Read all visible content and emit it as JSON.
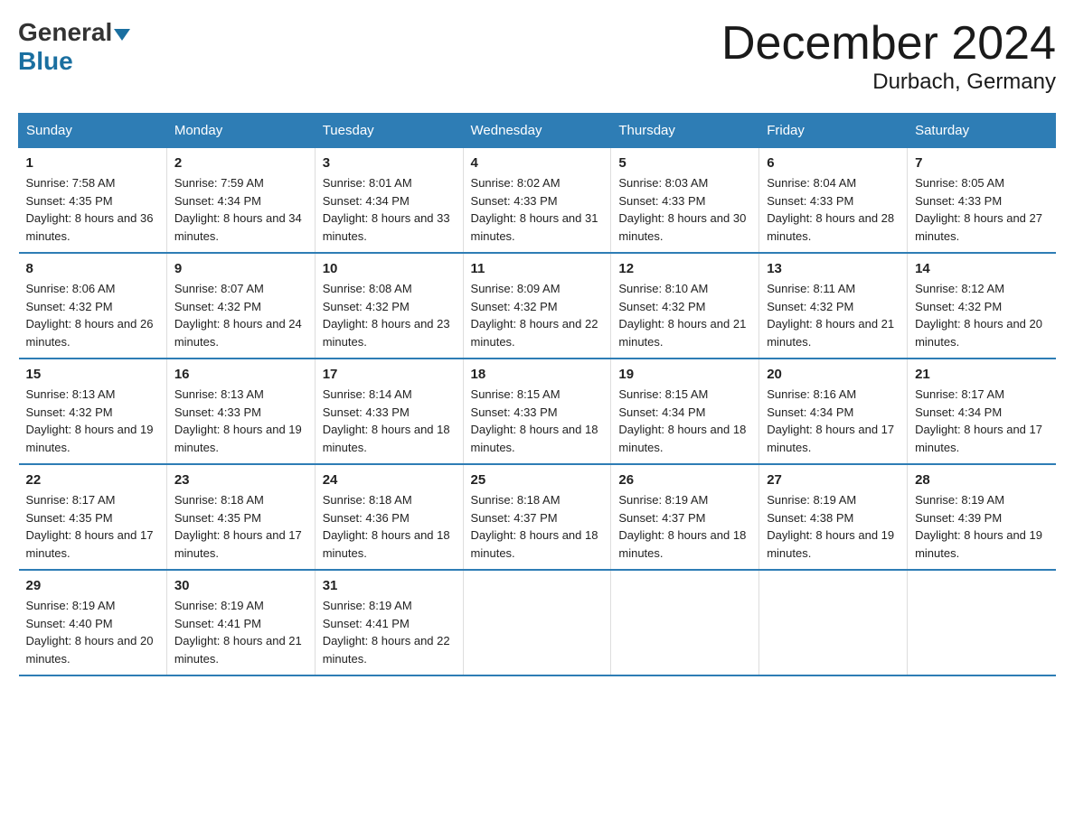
{
  "logo": {
    "general": "General",
    "triangle": "▲",
    "blue": "Blue"
  },
  "title": "December 2024",
  "subtitle": "Durbach, Germany",
  "days_header": [
    "Sunday",
    "Monday",
    "Tuesday",
    "Wednesday",
    "Thursday",
    "Friday",
    "Saturday"
  ],
  "weeks": [
    [
      {
        "day": "1",
        "sunrise": "7:58 AM",
        "sunset": "4:35 PM",
        "daylight": "8 hours and 36 minutes."
      },
      {
        "day": "2",
        "sunrise": "7:59 AM",
        "sunset": "4:34 PM",
        "daylight": "8 hours and 34 minutes."
      },
      {
        "day": "3",
        "sunrise": "8:01 AM",
        "sunset": "4:34 PM",
        "daylight": "8 hours and 33 minutes."
      },
      {
        "day": "4",
        "sunrise": "8:02 AM",
        "sunset": "4:33 PM",
        "daylight": "8 hours and 31 minutes."
      },
      {
        "day": "5",
        "sunrise": "8:03 AM",
        "sunset": "4:33 PM",
        "daylight": "8 hours and 30 minutes."
      },
      {
        "day": "6",
        "sunrise": "8:04 AM",
        "sunset": "4:33 PM",
        "daylight": "8 hours and 28 minutes."
      },
      {
        "day": "7",
        "sunrise": "8:05 AM",
        "sunset": "4:33 PM",
        "daylight": "8 hours and 27 minutes."
      }
    ],
    [
      {
        "day": "8",
        "sunrise": "8:06 AM",
        "sunset": "4:32 PM",
        "daylight": "8 hours and 26 minutes."
      },
      {
        "day": "9",
        "sunrise": "8:07 AM",
        "sunset": "4:32 PM",
        "daylight": "8 hours and 24 minutes."
      },
      {
        "day": "10",
        "sunrise": "8:08 AM",
        "sunset": "4:32 PM",
        "daylight": "8 hours and 23 minutes."
      },
      {
        "day": "11",
        "sunrise": "8:09 AM",
        "sunset": "4:32 PM",
        "daylight": "8 hours and 22 minutes."
      },
      {
        "day": "12",
        "sunrise": "8:10 AM",
        "sunset": "4:32 PM",
        "daylight": "8 hours and 21 minutes."
      },
      {
        "day": "13",
        "sunrise": "8:11 AM",
        "sunset": "4:32 PM",
        "daylight": "8 hours and 21 minutes."
      },
      {
        "day": "14",
        "sunrise": "8:12 AM",
        "sunset": "4:32 PM",
        "daylight": "8 hours and 20 minutes."
      }
    ],
    [
      {
        "day": "15",
        "sunrise": "8:13 AM",
        "sunset": "4:32 PM",
        "daylight": "8 hours and 19 minutes."
      },
      {
        "day": "16",
        "sunrise": "8:13 AM",
        "sunset": "4:33 PM",
        "daylight": "8 hours and 19 minutes."
      },
      {
        "day": "17",
        "sunrise": "8:14 AM",
        "sunset": "4:33 PM",
        "daylight": "8 hours and 18 minutes."
      },
      {
        "day": "18",
        "sunrise": "8:15 AM",
        "sunset": "4:33 PM",
        "daylight": "8 hours and 18 minutes."
      },
      {
        "day": "19",
        "sunrise": "8:15 AM",
        "sunset": "4:34 PM",
        "daylight": "8 hours and 18 minutes."
      },
      {
        "day": "20",
        "sunrise": "8:16 AM",
        "sunset": "4:34 PM",
        "daylight": "8 hours and 17 minutes."
      },
      {
        "day": "21",
        "sunrise": "8:17 AM",
        "sunset": "4:34 PM",
        "daylight": "8 hours and 17 minutes."
      }
    ],
    [
      {
        "day": "22",
        "sunrise": "8:17 AM",
        "sunset": "4:35 PM",
        "daylight": "8 hours and 17 minutes."
      },
      {
        "day": "23",
        "sunrise": "8:18 AM",
        "sunset": "4:35 PM",
        "daylight": "8 hours and 17 minutes."
      },
      {
        "day": "24",
        "sunrise": "8:18 AM",
        "sunset": "4:36 PM",
        "daylight": "8 hours and 18 minutes."
      },
      {
        "day": "25",
        "sunrise": "8:18 AM",
        "sunset": "4:37 PM",
        "daylight": "8 hours and 18 minutes."
      },
      {
        "day": "26",
        "sunrise": "8:19 AM",
        "sunset": "4:37 PM",
        "daylight": "8 hours and 18 minutes."
      },
      {
        "day": "27",
        "sunrise": "8:19 AM",
        "sunset": "4:38 PM",
        "daylight": "8 hours and 19 minutes."
      },
      {
        "day": "28",
        "sunrise": "8:19 AM",
        "sunset": "4:39 PM",
        "daylight": "8 hours and 19 minutes."
      }
    ],
    [
      {
        "day": "29",
        "sunrise": "8:19 AM",
        "sunset": "4:40 PM",
        "daylight": "8 hours and 20 minutes."
      },
      {
        "day": "30",
        "sunrise": "8:19 AM",
        "sunset": "4:41 PM",
        "daylight": "8 hours and 21 minutes."
      },
      {
        "day": "31",
        "sunrise": "8:19 AM",
        "sunset": "4:41 PM",
        "daylight": "8 hours and 22 minutes."
      },
      null,
      null,
      null,
      null
    ]
  ]
}
